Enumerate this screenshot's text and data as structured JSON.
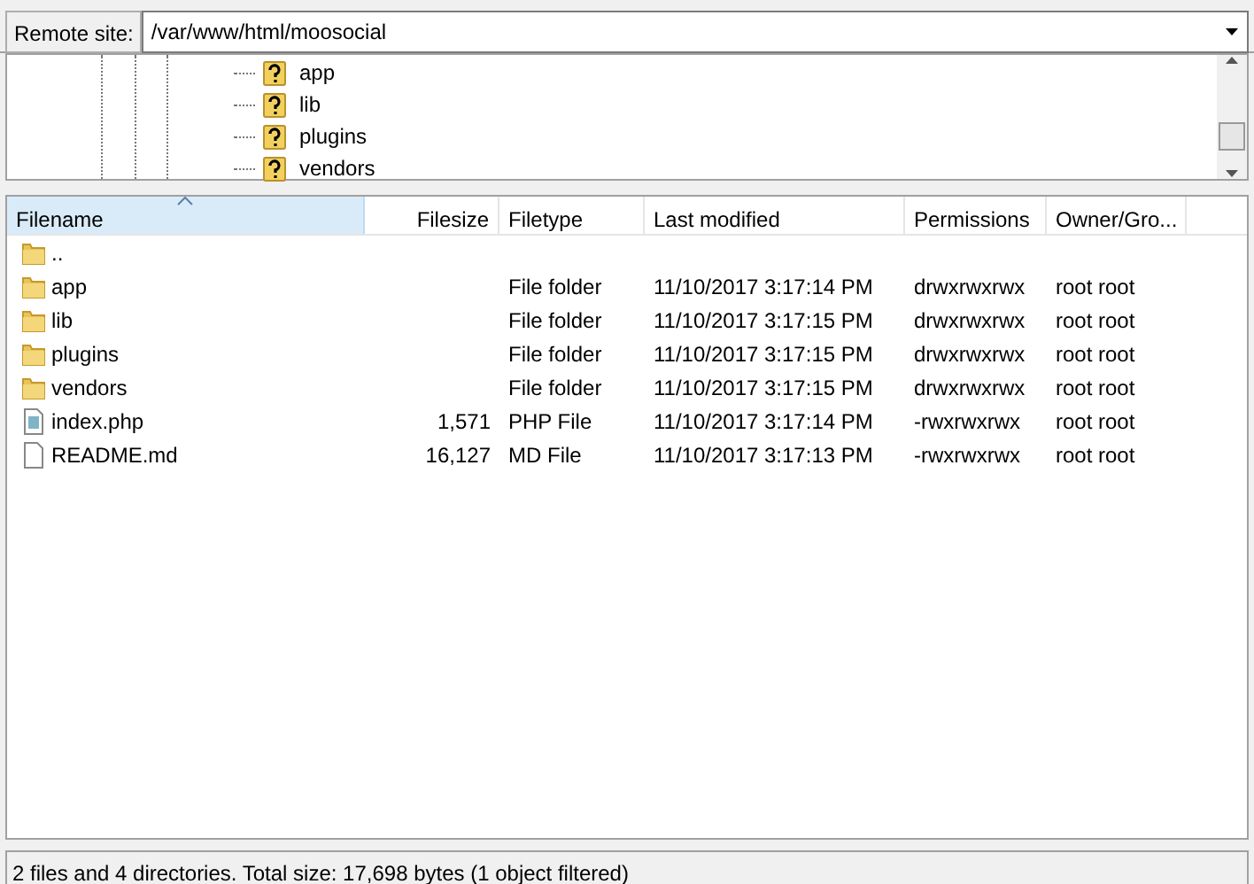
{
  "remote_site": {
    "label": "Remote site:",
    "value": "/var/www/html/moosocial"
  },
  "tree": {
    "items": [
      {
        "label": "app"
      },
      {
        "label": "lib"
      },
      {
        "label": "plugins"
      },
      {
        "label": "vendors"
      }
    ]
  },
  "file_list": {
    "columns": [
      {
        "label": "Filename",
        "sorted": true
      },
      {
        "label": "Filesize",
        "sorted": false
      },
      {
        "label": "Filetype",
        "sorted": false
      },
      {
        "label": "Last modified",
        "sorted": false
      },
      {
        "label": "Permissions",
        "sorted": false
      },
      {
        "label": "Owner/Gro..."
      }
    ],
    "rows": [
      {
        "kind": "folder",
        "name": ".."
      },
      {
        "kind": "folder",
        "name": "app",
        "filetype": "File folder",
        "modified": "11/10/2017 3:17:14 PM",
        "permissions": "drwxrwxrwx",
        "owner": "root root"
      },
      {
        "kind": "folder",
        "name": "lib",
        "filetype": "File folder",
        "modified": "11/10/2017 3:17:15 PM",
        "permissions": "drwxrwxrwx",
        "owner": "root root"
      },
      {
        "kind": "folder",
        "name": "plugins",
        "filetype": "File folder",
        "modified": "11/10/2017 3:17:15 PM",
        "permissions": "drwxrwxrwx",
        "owner": "root root"
      },
      {
        "kind": "folder",
        "name": "vendors",
        "filetype": "File folder",
        "modified": "11/10/2017 3:17:15 PM",
        "permissions": "drwxrwxrwx",
        "owner": "root root"
      },
      {
        "kind": "script",
        "name": "index.php",
        "filesize": "1,571",
        "filetype": "PHP File",
        "modified": "11/10/2017 3:17:14 PM",
        "permissions": "-rwxrwxrwx",
        "owner": "root root"
      },
      {
        "kind": "file",
        "name": "README.md",
        "filesize": "16,127",
        "filetype": "MD File",
        "modified": "11/10/2017 3:17:13 PM",
        "permissions": "-rwxrwxrwx",
        "owner": "root root"
      }
    ]
  },
  "status_bar": "2 files and 4 directories. Total size: 17,698 bytes (1 object filtered)"
}
